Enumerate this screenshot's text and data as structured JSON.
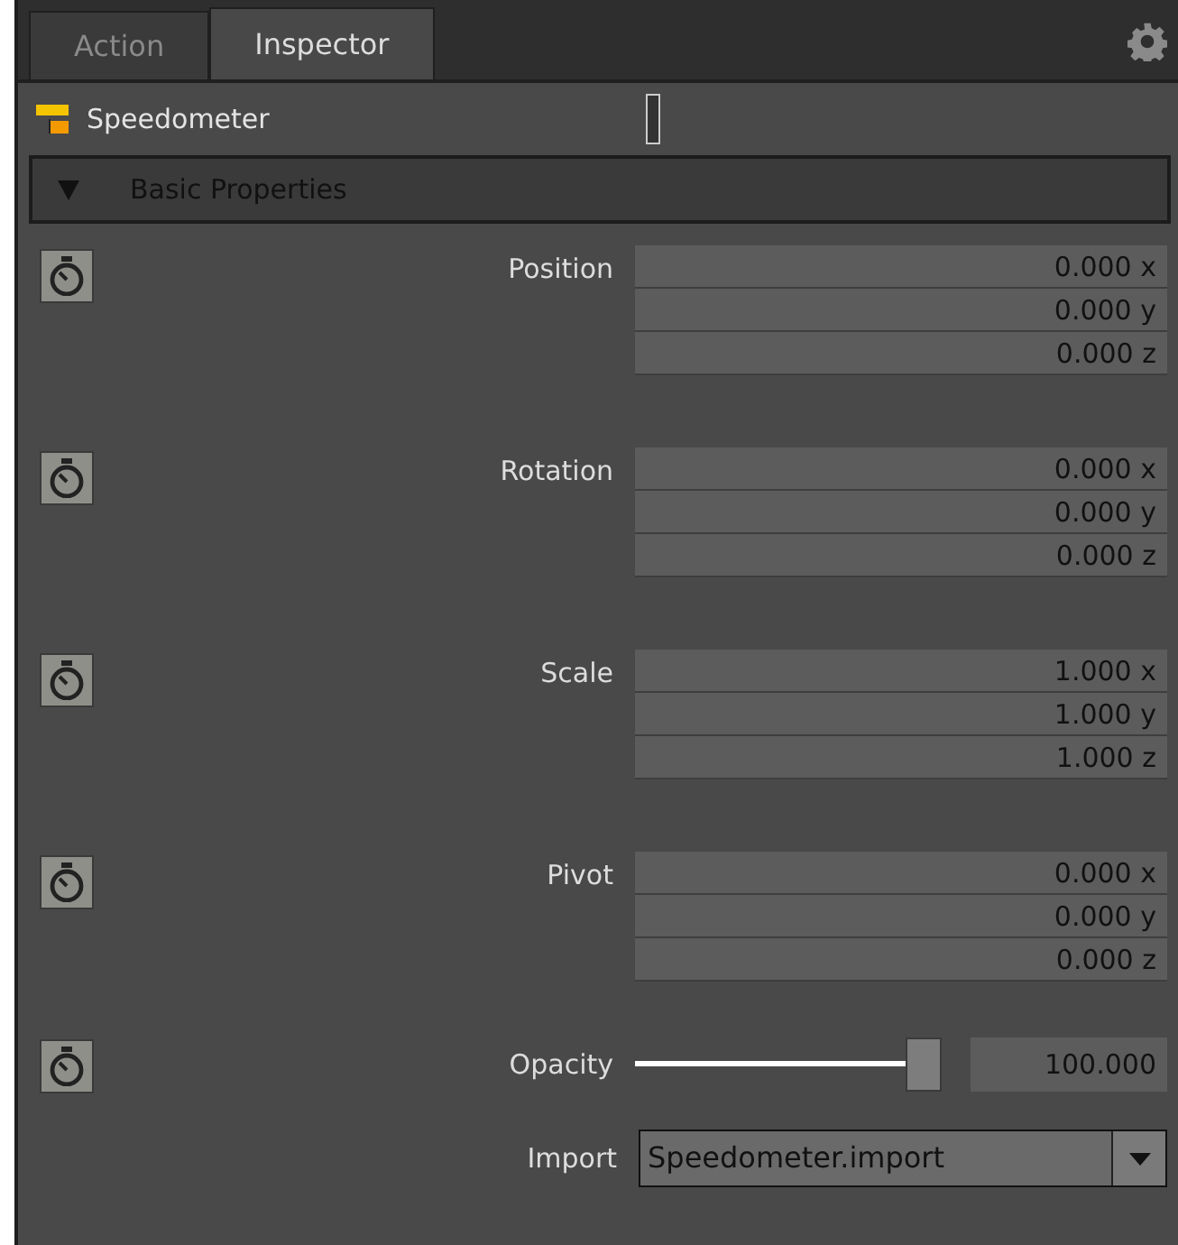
{
  "tabs": [
    {
      "label": "Action",
      "selected": false
    },
    {
      "label": "Inspector",
      "selected": true
    }
  ],
  "object": {
    "name": "Speedometer"
  },
  "section": {
    "title": "Basic Properties",
    "expanded": true
  },
  "properties": [
    {
      "kind": "vector",
      "label": "Position",
      "values": [
        "0.000 x",
        "0.000 y",
        "0.000 z"
      ]
    },
    {
      "kind": "vector",
      "label": "Rotation",
      "values": [
        "0.000 x",
        "0.000 y",
        "0.000 z"
      ]
    },
    {
      "kind": "vector",
      "label": "Scale",
      "values": [
        "1.000 x",
        "1.000 y",
        "1.000 z"
      ]
    },
    {
      "kind": "vector",
      "label": "Pivot",
      "values": [
        "0.000 x",
        "0.000 y",
        "0.000 z"
      ]
    },
    {
      "kind": "slider",
      "label": "Opacity",
      "level": 1,
      "value": "100.000"
    },
    {
      "kind": "dropdown",
      "label": "Import",
      "value": "Speedometer.import"
    }
  ]
}
